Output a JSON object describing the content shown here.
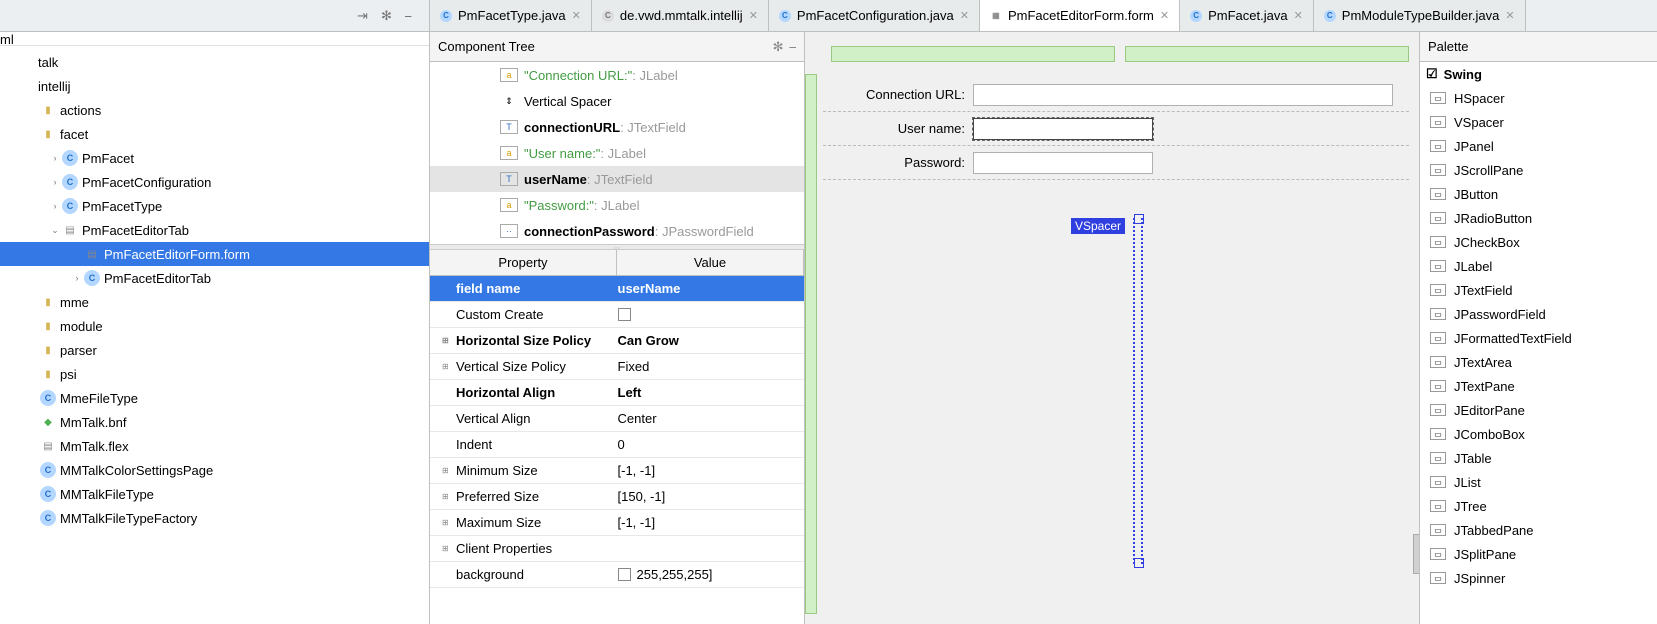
{
  "tabs": [
    {
      "label": "PmFacetType.java",
      "kind": "blue"
    },
    {
      "label": "de.vwd.mmtalk.intellij",
      "kind": "grey"
    },
    {
      "label": "PmFacetConfiguration.java",
      "kind": "blue"
    },
    {
      "label": "PmFacetEditorForm.form",
      "kind": "form",
      "active": true
    },
    {
      "label": "PmFacet.java",
      "kind": "blue"
    },
    {
      "label": "PmModuleTypeBuilder.java",
      "kind": "blue"
    }
  ],
  "project": {
    "breadcrumb": "ml",
    "nodes": [
      {
        "indent": 0,
        "arrow": "",
        "icon": "",
        "label": "talk"
      },
      {
        "indent": 0,
        "arrow": "",
        "icon": "",
        "label": "intellij"
      },
      {
        "indent": 1,
        "arrow": "",
        "icon": "folder",
        "label": "actions"
      },
      {
        "indent": 1,
        "arrow": "",
        "icon": "folder",
        "label": "facet"
      },
      {
        "indent": 2,
        "arrow": "›",
        "icon": "cls",
        "label": "PmFacet"
      },
      {
        "indent": 2,
        "arrow": "›",
        "icon": "cls",
        "label": "PmFacetConfiguration"
      },
      {
        "indent": 2,
        "arrow": "›",
        "icon": "cls",
        "label": "PmFacetType"
      },
      {
        "indent": 2,
        "arrow": "⌄",
        "icon": "file",
        "label": "PmFacetEditorTab"
      },
      {
        "indent": 3,
        "arrow": "",
        "icon": "file",
        "label": "PmFacetEditorForm.form",
        "sel": true
      },
      {
        "indent": 3,
        "arrow": "›",
        "icon": "cls",
        "label": "PmFacetEditorTab"
      },
      {
        "indent": 1,
        "arrow": "",
        "icon": "folder",
        "label": "mme"
      },
      {
        "indent": 1,
        "arrow": "",
        "icon": "folder",
        "label": "module"
      },
      {
        "indent": 1,
        "arrow": "",
        "icon": "folder",
        "label": "parser"
      },
      {
        "indent": 1,
        "arrow": "",
        "icon": "folder",
        "label": "psi"
      },
      {
        "indent": 1,
        "arrow": "",
        "icon": "cls",
        "label": "MmeFileType"
      },
      {
        "indent": 1,
        "arrow": "",
        "icon": "bnf",
        "label": "MmTalk.bnf"
      },
      {
        "indent": 1,
        "arrow": "",
        "icon": "file",
        "label": "MmTalk.flex"
      },
      {
        "indent": 1,
        "arrow": "",
        "icon": "cls",
        "label": "MMTalkColorSettingsPage"
      },
      {
        "indent": 1,
        "arrow": "",
        "icon": "cls",
        "label": "MMTalkFileType"
      },
      {
        "indent": 1,
        "arrow": "",
        "icon": "cls",
        "label": "MMTalkFileTypeFactory"
      }
    ]
  },
  "componentTree": {
    "title": "Component Tree",
    "items": [
      {
        "name": "\"Connection URL:\"",
        "type": ": JLabel",
        "green": true,
        "ic": "lbl"
      },
      {
        "name": "Vertical Spacer",
        "type": "",
        "ic": "vsp"
      },
      {
        "name": "connectionURL",
        "type": ": JTextField",
        "bold": true,
        "ic": "txt"
      },
      {
        "name": "\"User name:\"",
        "type": ": JLabel",
        "green": true,
        "ic": "lbl"
      },
      {
        "name": "userName",
        "type": ": JTextField",
        "bold": true,
        "sel": true,
        "ic": "txt"
      },
      {
        "name": "\"Password:\"",
        "type": ": JLabel",
        "green": true,
        "ic": "lbl"
      },
      {
        "name": "connectionPassword",
        "type": ": JPasswordField",
        "bold": true,
        "ic": "pwd"
      }
    ]
  },
  "properties": {
    "headers": {
      "p": "Property",
      "v": "Value"
    },
    "rows": [
      {
        "p": "field name",
        "v": "userName",
        "first": true
      },
      {
        "p": "Custom Create",
        "v": "",
        "chk": true,
        "exp": ""
      },
      {
        "p": "Horizontal Size Policy",
        "v": "Can Grow",
        "bold": true,
        "exp": "⊞"
      },
      {
        "p": "Vertical Size Policy",
        "v": "Fixed",
        "exp": "⊞"
      },
      {
        "p": "Horizontal Align",
        "v": "Left",
        "bold": true,
        "exp": ""
      },
      {
        "p": "Vertical Align",
        "v": "Center",
        "exp": ""
      },
      {
        "p": "Indent",
        "v": "0",
        "exp": ""
      },
      {
        "p": "Minimum Size",
        "v": "[-1, -1]",
        "exp": "⊞"
      },
      {
        "p": "Preferred Size",
        "v": "[150, -1]",
        "exp": "⊞"
      },
      {
        "p": "Maximum Size",
        "v": "[-1, -1]",
        "exp": "⊞"
      },
      {
        "p": "Client Properties",
        "v": "",
        "exp": "⊞"
      },
      {
        "p": "background",
        "v": "255,255,255]",
        "swatch": true,
        "exp": ""
      }
    ]
  },
  "form": {
    "rows": [
      {
        "label": "Connection URL:",
        "sel": false,
        "wide": true
      },
      {
        "label": "User name:",
        "sel": true,
        "wide": false
      },
      {
        "label": "Password:",
        "sel": false,
        "wide": false
      }
    ],
    "vspacer": "VSpacer"
  },
  "palette": {
    "title": "Palette",
    "group": "Swing",
    "items": [
      "HSpacer",
      "VSpacer",
      "JPanel",
      "JScrollPane",
      "JButton",
      "JRadioButton",
      "JCheckBox",
      "JLabel",
      "JTextField",
      "JPasswordField",
      "JFormattedTextField",
      "JTextArea",
      "JTextPane",
      "JEditorPane",
      "JComboBox",
      "JTable",
      "JList",
      "JTree",
      "JTabbedPane",
      "JSplitPane",
      "JSpinner"
    ]
  }
}
